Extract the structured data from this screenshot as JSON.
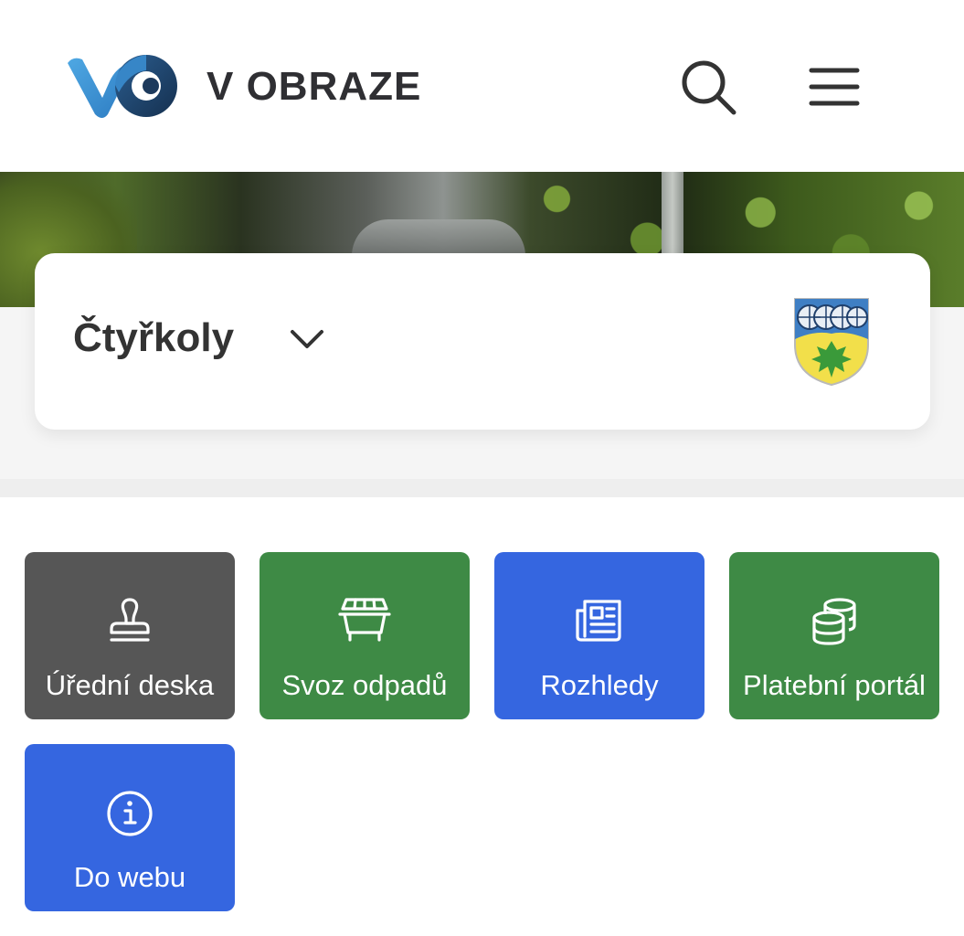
{
  "header": {
    "brand": "V OBRAZE",
    "search_icon": "search-icon",
    "menu_icon": "hamburger-menu-icon"
  },
  "town": {
    "name": "Čtyřkoly",
    "dropdown_icon": "chevron-down-icon",
    "coat_of_arms": "coat-of-arms-icon"
  },
  "tiles": [
    {
      "label": "Úřední deska",
      "icon": "stamp-icon",
      "color": "#565656"
    },
    {
      "label": "Svoz odpadů",
      "icon": "dumpster-icon",
      "color": "#3e8a45"
    },
    {
      "label": "Rozhledy",
      "icon": "newspaper-icon",
      "color": "#3566e0"
    },
    {
      "label": "Platební portál",
      "icon": "coins-icon",
      "color": "#3e8a45"
    },
    {
      "label": "Do webu",
      "icon": "info-icon",
      "color": "#3566e0"
    }
  ],
  "colors": {
    "logo_blue": "#3a8fd6",
    "logo_dark": "#1e3f66",
    "text_dark": "#2f2f33"
  }
}
